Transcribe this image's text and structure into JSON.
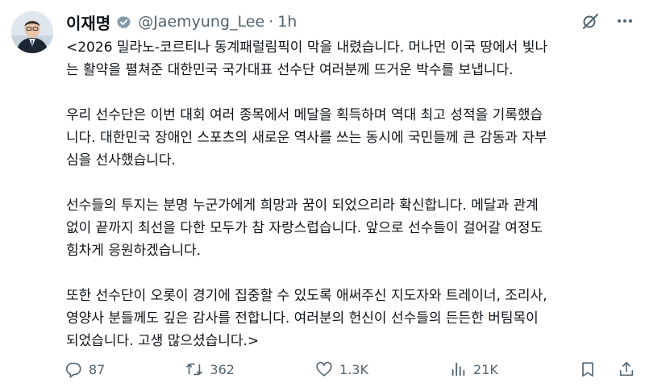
{
  "author": {
    "display_name": "이재명",
    "handle": "@Jaemyung_Lee",
    "separator": "·",
    "time": "1h"
  },
  "tweet_body": {
    "paragraphs": [
      [
        "<2026 밀라노-코르티나 동계패럴림픽이 막을 내렸습니다. 머나먼 이국 땅에서 빛나",
        "는 활약을 펼쳐준 대한민국 국가대표 선수단 여러분께 뜨거운 박수를 보냅니다."
      ],
      [
        "우리 선수단은 이번 대회 여러 종목에서 메달을 획득하며 역대 최고 성적을 기록했습",
        "니다. 대한민국 장애인 스포츠의 새로운 역사를 쓰는 동시에 국민들께 큰 감동과 자부",
        "심을 선사했습니다."
      ],
      [
        "선수들의 투지는 분명 누군가에게 희망과 꿈이 되었으리라 확신합니다. 메달과 관계",
        "없이 끝까지 최선을 다한 모두가 참 자랑스럽습니다. 앞으로 선수들이 걸어갈 여정도",
        "힘차게 응원하겠습니다."
      ],
      [
        "또한 선수단이 오롯이 경기에 집중할 수 있도록 애써주신 지도자와 트레이너, 조리사,",
        "영양사 분들께도 깊은 감사를 전합니다. 여러분의 헌신이 선수들의 든든한 버팀목이",
        "되었습니다. 고생 많으셨습니다.>"
      ]
    ]
  },
  "stats": {
    "replies": "87",
    "reposts": "362",
    "likes": "1.3K",
    "views": "21K"
  },
  "icons": {
    "verified": "verified-badge-icon",
    "grok": "grok-icon",
    "more": "more-icon",
    "reply": "reply-icon",
    "repost": "repost-icon",
    "like": "like-icon",
    "views": "views-icon",
    "bookmark": "bookmark-icon",
    "share": "share-icon"
  },
  "colors": {
    "text": "#0f1419",
    "secondary": "#536471",
    "verified_badge": "#829aab"
  }
}
